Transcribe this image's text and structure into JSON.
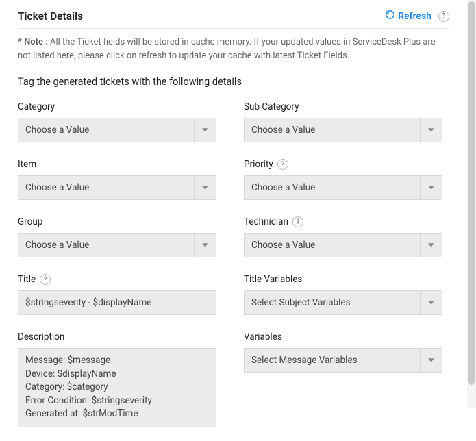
{
  "header": {
    "title": "Ticket Details",
    "refresh_label": "Refresh"
  },
  "note": {
    "label": "* Note :",
    "text": " All the Ticket fields will be stored in cache memory. If your updated values in ServiceDesk Plus are not listed here, please click on refresh to update your cache with latest Ticket Fields."
  },
  "section_title": "Tag the generated tickets with the following details",
  "fields": {
    "category": {
      "label": "Category",
      "value": "Choose a Value"
    },
    "sub_category": {
      "label": "Sub Category",
      "value": "Choose a Value"
    },
    "item": {
      "label": "Item",
      "value": "Choose a Value"
    },
    "priority": {
      "label": "Priority",
      "value": "Choose a Value"
    },
    "group": {
      "label": "Group",
      "value": "Choose a Value"
    },
    "technician": {
      "label": "Technician",
      "value": "Choose a Value"
    },
    "title": {
      "label": "Title",
      "value": "$stringseverity - $displayName"
    },
    "title_variables": {
      "label": "Title Variables",
      "value": "Select Subject Variables"
    },
    "description": {
      "label": "Description",
      "value": "Message: $message\nDevice: $displayName\nCategory: $category\nError Condition: $stringseverity\nGenerated at: $strModTime"
    },
    "variables": {
      "label": "Variables",
      "value": "Select Message Variables"
    }
  }
}
